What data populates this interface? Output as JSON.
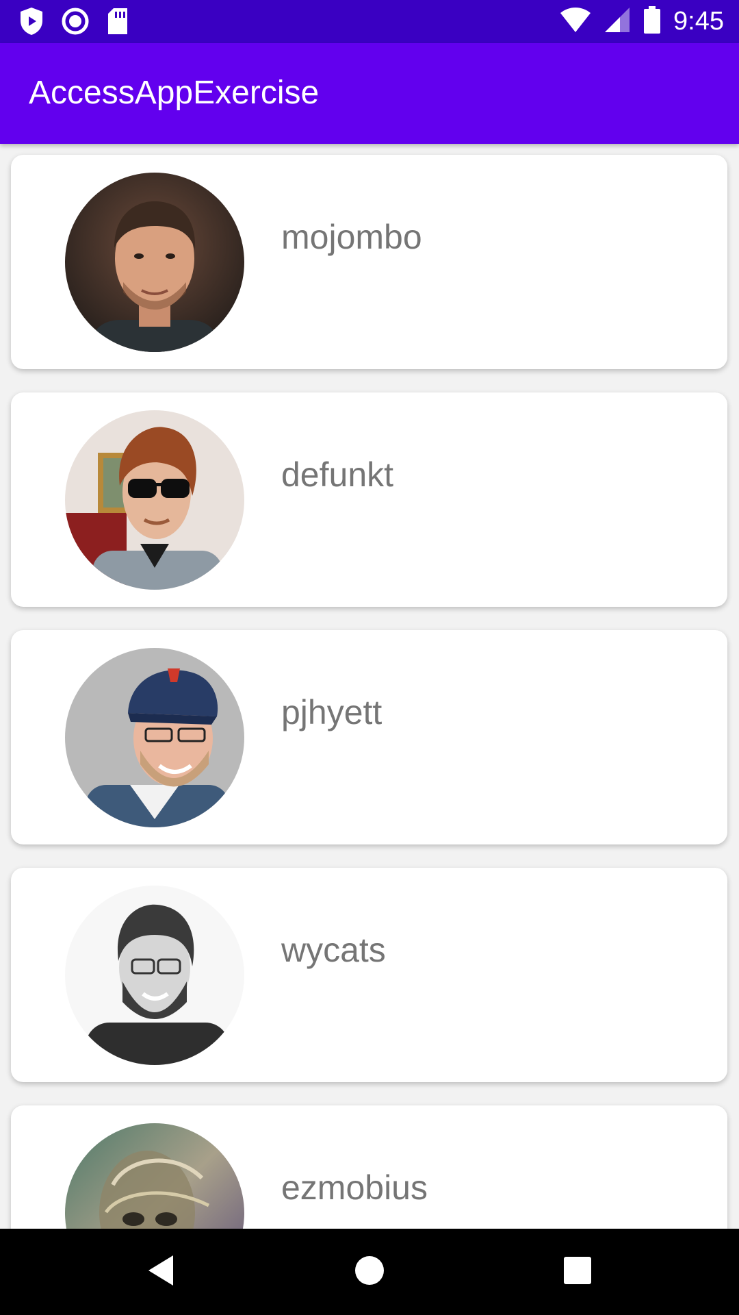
{
  "status_bar": {
    "time": "9:45",
    "left_icons": [
      "play-protect-icon",
      "radio-circle-icon",
      "sd-card-icon"
    ],
    "right_icons": [
      "wifi-icon",
      "cell-signal-icon",
      "battery-icon"
    ]
  },
  "app_bar": {
    "title": "AccessAppExercise",
    "color": "#6200ee"
  },
  "users": [
    {
      "login": "mojombo",
      "avatar": "photo-avatar"
    },
    {
      "login": "defunkt",
      "avatar": "photo-avatar"
    },
    {
      "login": "pjhyett",
      "avatar": "photo-avatar"
    },
    {
      "login": "wycats",
      "avatar": "photo-avatar"
    },
    {
      "login": "ezmobius",
      "avatar": "photo-avatar"
    }
  ],
  "nav_bar": {
    "buttons": [
      "back-icon",
      "home-icon",
      "recents-icon"
    ]
  },
  "colors": {
    "status_bar": "#3a00c2",
    "app_bar": "#6200ee",
    "username_text": "#757575",
    "background": "#f2f2f2"
  }
}
